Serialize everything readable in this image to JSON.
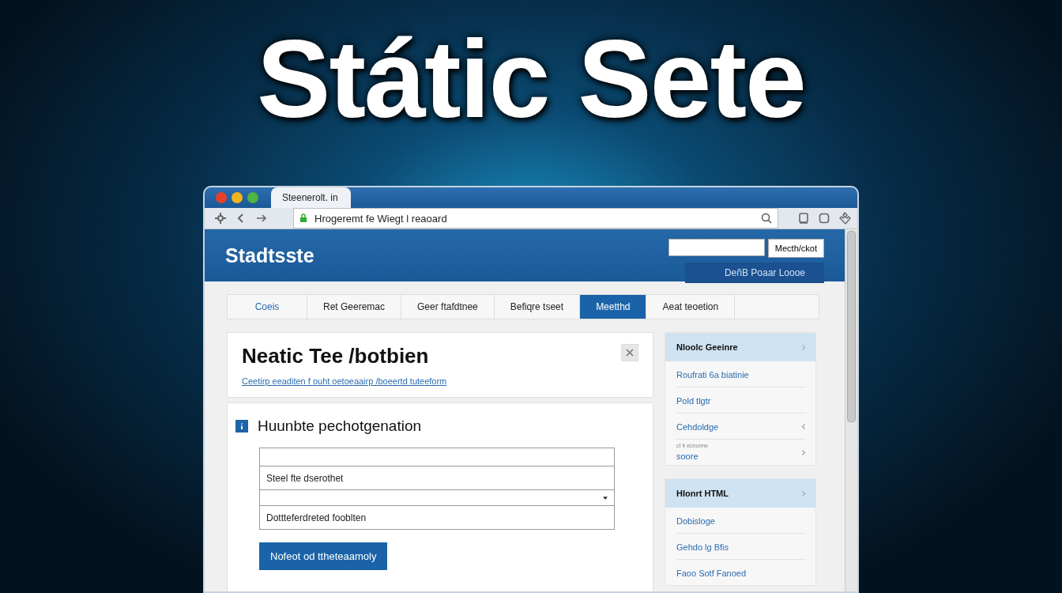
{
  "headline": "Státic Sete",
  "browser": {
    "tab_title": "Steenerolt. in",
    "address": "Hrogeremt fe Wiegt l reaoard"
  },
  "site": {
    "logo": "Stadtsste",
    "search_button": "Mecth/ckot",
    "header_link": "DeñB Poaar Loooe",
    "nav": [
      {
        "label": "Coeis",
        "selected": false
      },
      {
        "label": "Ret Geeremac",
        "selected": false
      },
      {
        "label": "Geer ftafdtnee",
        "selected": false
      },
      {
        "label": "Befiqre tseet",
        "selected": false
      },
      {
        "label": "Meetthd",
        "selected": true
      },
      {
        "label": "Aeat teoetion",
        "selected": false
      }
    ],
    "hero": {
      "heading": "Neatic Tee /botbien",
      "link": "Ceetirp eeaditen f ouht oetoeaairp /boeertd tuteeform"
    },
    "form": {
      "heading": "Huunbte pechotgenation",
      "fields": [
        {
          "kind": "text"
        },
        {
          "kind": "text",
          "value": "Steel fte dserothet"
        },
        {
          "kind": "select"
        },
        {
          "kind": "text",
          "value": "Dottteferdreted fooblten"
        }
      ],
      "button": "Nofeot od ttheteaamoly"
    },
    "sidebar": [
      {
        "header": "Nloolc Geeinre",
        "items": [
          {
            "text": "Roufrati 6a biatinie",
            "kind": "plain"
          },
          {
            "text": "Pold tlgtr",
            "kind": "plain"
          },
          {
            "text": "Cehdoldge",
            "kind": "left_arrow"
          },
          {
            "note": "ct ¢ ecnunne",
            "text": "soore",
            "kind": "right_arrow"
          }
        ]
      },
      {
        "header": "Hlonrt HTML",
        "items": [
          {
            "text": "Dobisloge",
            "kind": "plain"
          },
          {
            "text": "Gehdo lg Bfis",
            "kind": "plain"
          },
          {
            "text": "Faoo Sotf Fanoed",
            "kind": "plain"
          }
        ]
      }
    ]
  }
}
